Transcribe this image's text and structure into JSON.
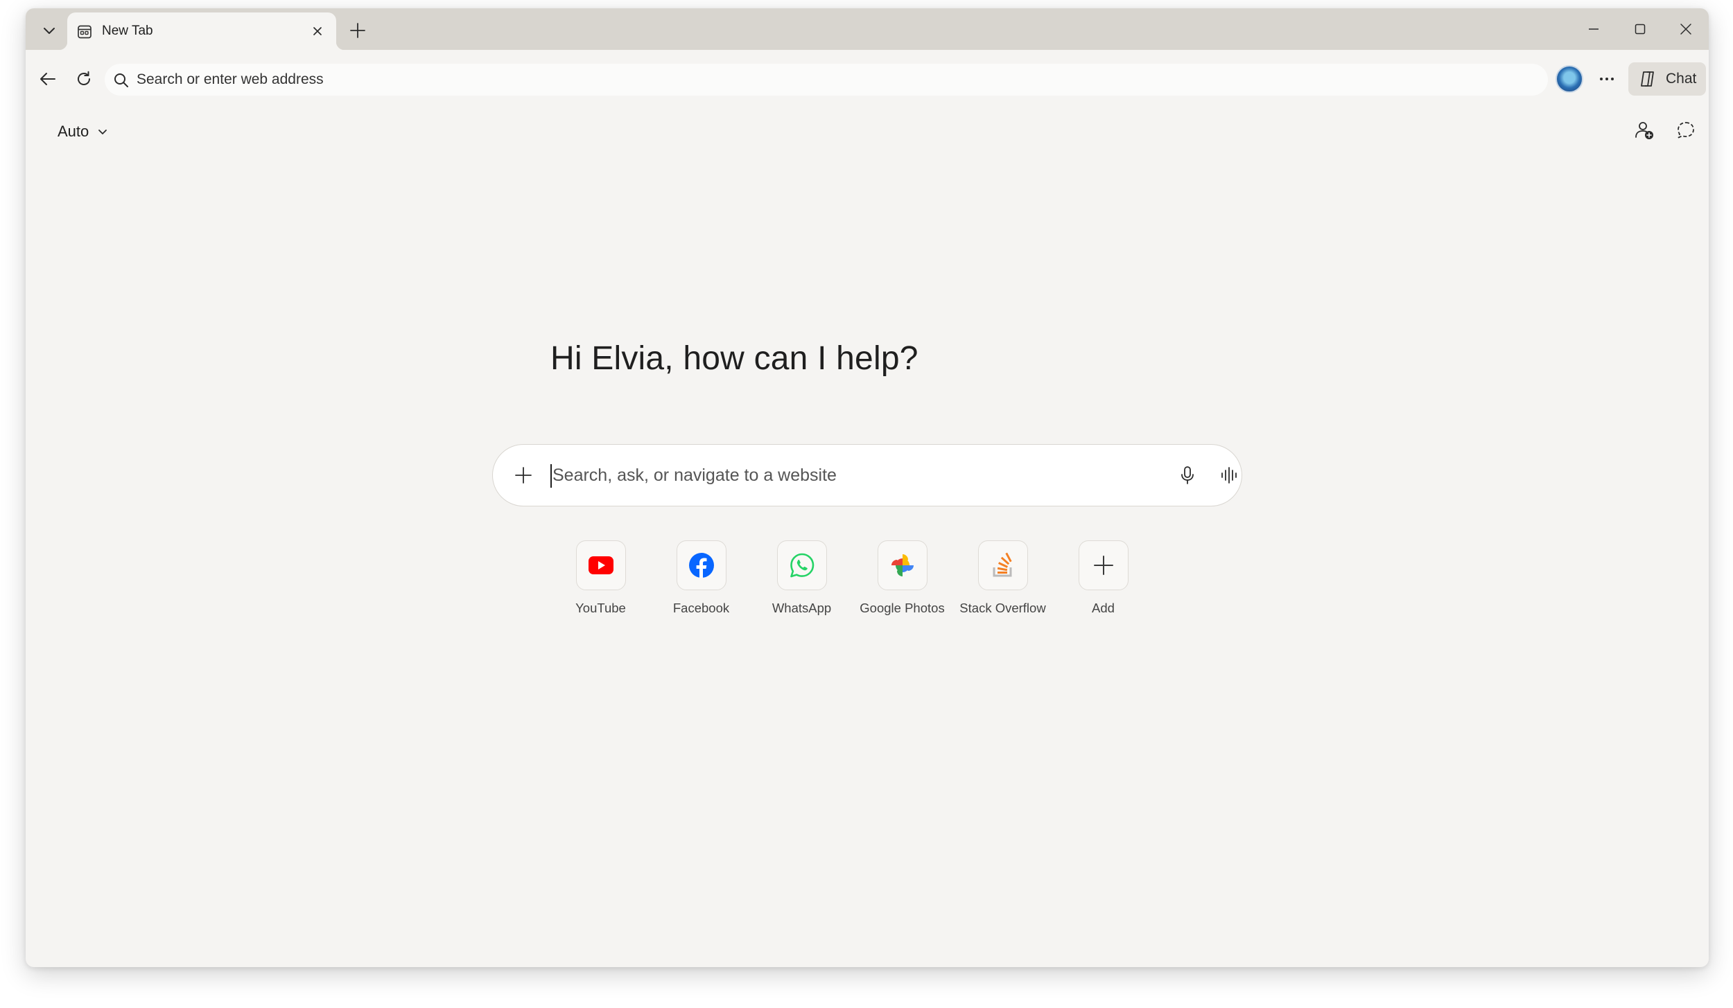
{
  "tabstrip": {
    "tabs": [
      {
        "title": "New Tab"
      }
    ]
  },
  "toolbar": {
    "address_placeholder": "Search or enter web address",
    "chat_label": "Chat"
  },
  "page": {
    "theme_label": "Auto",
    "greeting": "Hi Elvia, how can I help?",
    "search_placeholder": "Search, ask, or navigate to a website",
    "shortcuts": [
      {
        "name": "YouTube",
        "icon": "youtube-icon"
      },
      {
        "name": "Facebook",
        "icon": "facebook-icon"
      },
      {
        "name": "WhatsApp",
        "icon": "whatsapp-icon"
      },
      {
        "name": "Google Photos",
        "icon": "google-photos-icon"
      },
      {
        "name": "Stack Overflow",
        "icon": "stack-overflow-icon"
      },
      {
        "name": "Add",
        "icon": "plus-icon"
      }
    ]
  },
  "colors": {
    "window_bg": "#f5f4f2",
    "tabstrip_bg": "#d8d5cf",
    "youtube": "#ff0000",
    "facebook": "#0866ff",
    "whatsapp": "#25d366",
    "stackoverflow": "#f48024"
  }
}
